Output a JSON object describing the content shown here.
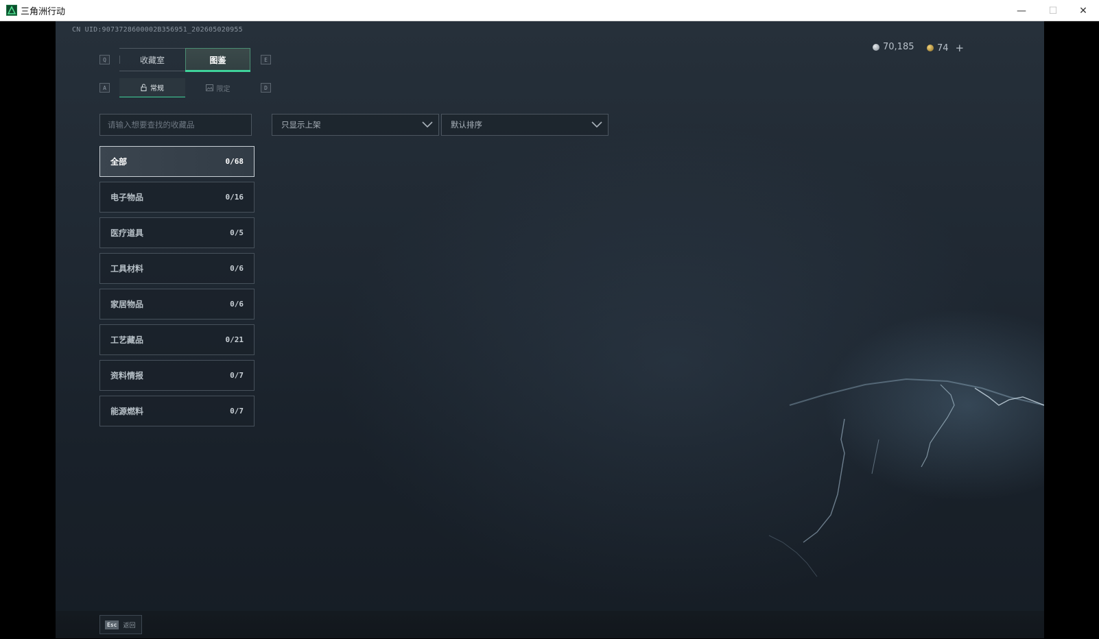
{
  "window": {
    "title": "三角洲行动",
    "minimize_icon": "—",
    "maximize_icon": "☐",
    "close_icon": "✕"
  },
  "header": {
    "uid": "CN UID:9073728600002B356951_202605020955",
    "currency_silver": "70,185",
    "currency_gold": "74",
    "add_label": "+"
  },
  "tabs": {
    "key_left": "Q",
    "key_right": "E",
    "items": [
      {
        "label": "收藏室",
        "active": false
      },
      {
        "label": "图鉴",
        "active": true
      }
    ]
  },
  "subtabs": {
    "key_left": "A",
    "key_right": "D",
    "items": [
      {
        "label": "常规",
        "active": true
      },
      {
        "label": "限定",
        "active": false
      }
    ]
  },
  "search": {
    "placeholder": "请输入想要查找的收藏品"
  },
  "filters": {
    "availability": "只显示上架",
    "sort": "默认排序"
  },
  "categories": [
    {
      "label": "全部",
      "count": "0/68",
      "active": true
    },
    {
      "label": "电子物品",
      "count": "0/16"
    },
    {
      "label": "医疗道具",
      "count": "0/5"
    },
    {
      "label": "工具材料",
      "count": "0/6"
    },
    {
      "label": "家居物品",
      "count": "0/6"
    },
    {
      "label": "工艺藏品",
      "count": "0/21"
    },
    {
      "label": "资料情报",
      "count": "0/7"
    },
    {
      "label": "能源燃料",
      "count": "0/7"
    }
  ],
  "footer": {
    "esc_key": "Esc",
    "back_label": "返回"
  },
  "colors": {
    "accent": "#3fd39b",
    "background": "#1f2832"
  }
}
